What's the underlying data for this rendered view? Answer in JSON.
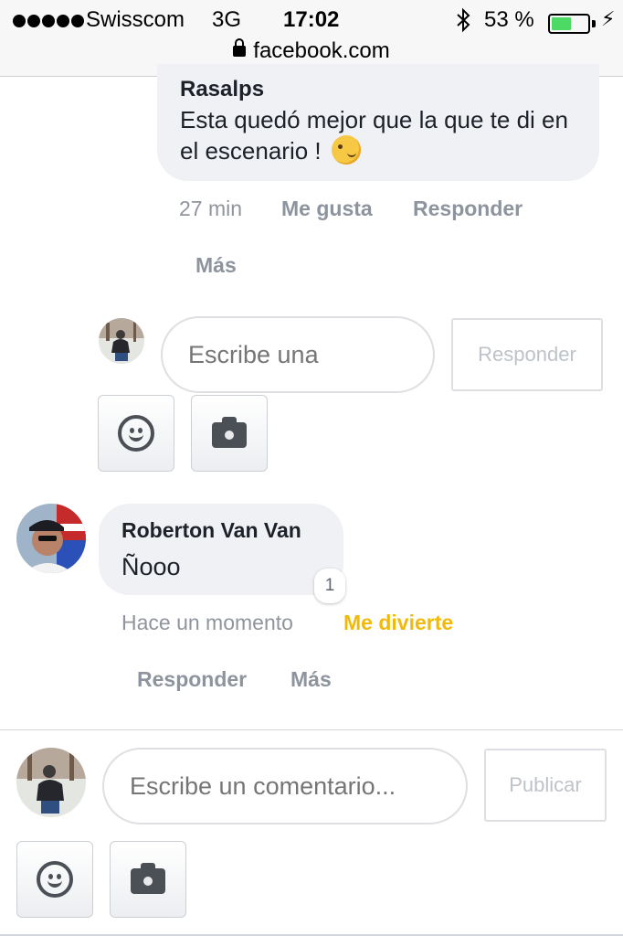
{
  "status_bar": {
    "carrier": "Swisscom",
    "network": "3G",
    "time": "17:02",
    "battery": "53 %",
    "battery_level": 0.53,
    "url": "facebook.com",
    "icons": [
      "signal-icon",
      "bluetooth-icon",
      "battery-icon",
      "charging-icon",
      "lock-icon"
    ]
  },
  "comment1": {
    "author": "Rasalps",
    "text": "Esta quedó mejor que la que te di en el escenario !",
    "emoji": "wink-emoji",
    "time": "27 min",
    "like": "Me gusta",
    "reply": "Responder",
    "more": "Más"
  },
  "reply_box": {
    "placeholder": "Escribe una",
    "submit": "Responder",
    "icons": [
      "smiley-icon",
      "camera-icon"
    ]
  },
  "comment2": {
    "author": "Roberton Van Van",
    "text": "Ñooo",
    "reaction_count": "1",
    "time": "Hace un momento",
    "reaction": "Me divierte",
    "reply": "Responder",
    "more": "Más"
  },
  "comment_box": {
    "placeholder": "Escribe un comentario...",
    "submit": "Publicar"
  },
  "colors": {
    "bubble": "#f0f1f4",
    "meta": "#90949c",
    "haha": "#f0b90b",
    "battery_fill": "#4cd964"
  }
}
